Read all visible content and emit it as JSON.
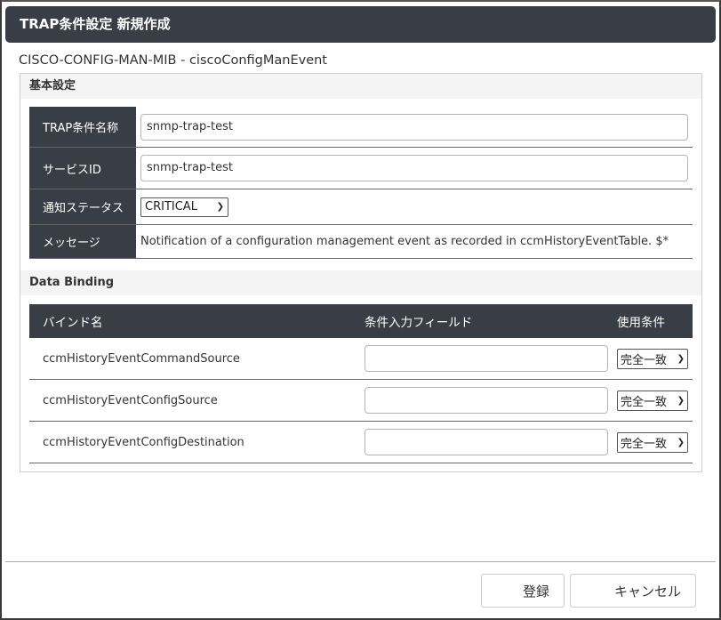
{
  "window": {
    "title": "TRAP条件設定 新規作成",
    "subtitle": "CISCO-CONFIG-MAN-MIB - ciscoConfigManEvent"
  },
  "basic": {
    "section_title": "基本設定",
    "fields": {
      "trap_name": {
        "label": "TRAP条件名称",
        "value": "snmp-trap-test"
      },
      "service_id": {
        "label": "サービスID",
        "value": "snmp-trap-test"
      },
      "status": {
        "label": "通知ステータス",
        "value": "CRITICAL"
      },
      "message": {
        "label": "メッセージ",
        "value": "Notification of a configuration management event as recorded in ccmHistoryEventTable. $*"
      }
    }
  },
  "binding": {
    "section_title": "Data Binding",
    "headers": [
      "バインド名",
      "条件入力フィールド",
      "使用条件"
    ],
    "rows": [
      {
        "name": "ccmHistoryEventCommandSource",
        "value": "",
        "condition": "完全一致"
      },
      {
        "name": "ccmHistoryEventConfigSource",
        "value": "",
        "condition": "完全一致"
      },
      {
        "name": "ccmHistoryEventConfigDestination",
        "value": "",
        "condition": "完全一致"
      }
    ]
  },
  "footer": {
    "register_label": "登録",
    "cancel_label": "キャンセル"
  }
}
